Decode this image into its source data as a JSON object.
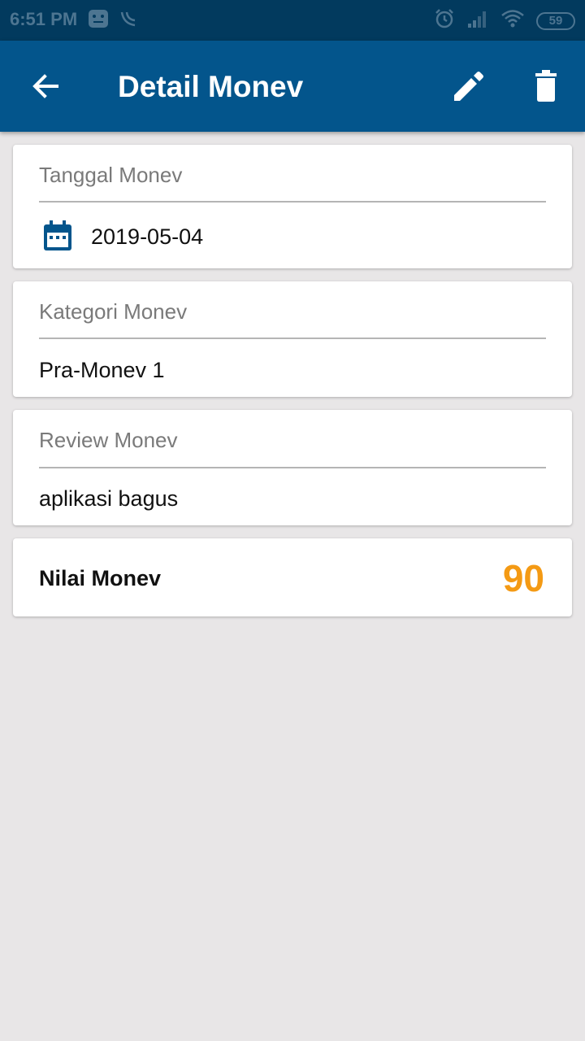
{
  "status_bar": {
    "time": "6:51 PM",
    "battery": "59",
    "icons": [
      "app-notification-icon",
      "signal-arc-icon",
      "alarm-icon",
      "cell-signal-icon",
      "wifi-icon",
      "battery-icon"
    ]
  },
  "app_bar": {
    "title": "Detail Monev",
    "icons": [
      "back-arrow-icon",
      "edit-pencil-icon",
      "trash-icon"
    ],
    "background": "#03558c"
  },
  "tanggal": {
    "label": "Tanggal Monev",
    "value": "2019-05-04",
    "icon": "calendar-icon"
  },
  "kategori": {
    "label": "Kategori Monev",
    "value": "Pra-Monev 1"
  },
  "review": {
    "label": "Review Monev",
    "value": "aplikasi bagus"
  },
  "nilai": {
    "label": "Nilai Monev",
    "value": "90",
    "color": "#f49a14"
  }
}
